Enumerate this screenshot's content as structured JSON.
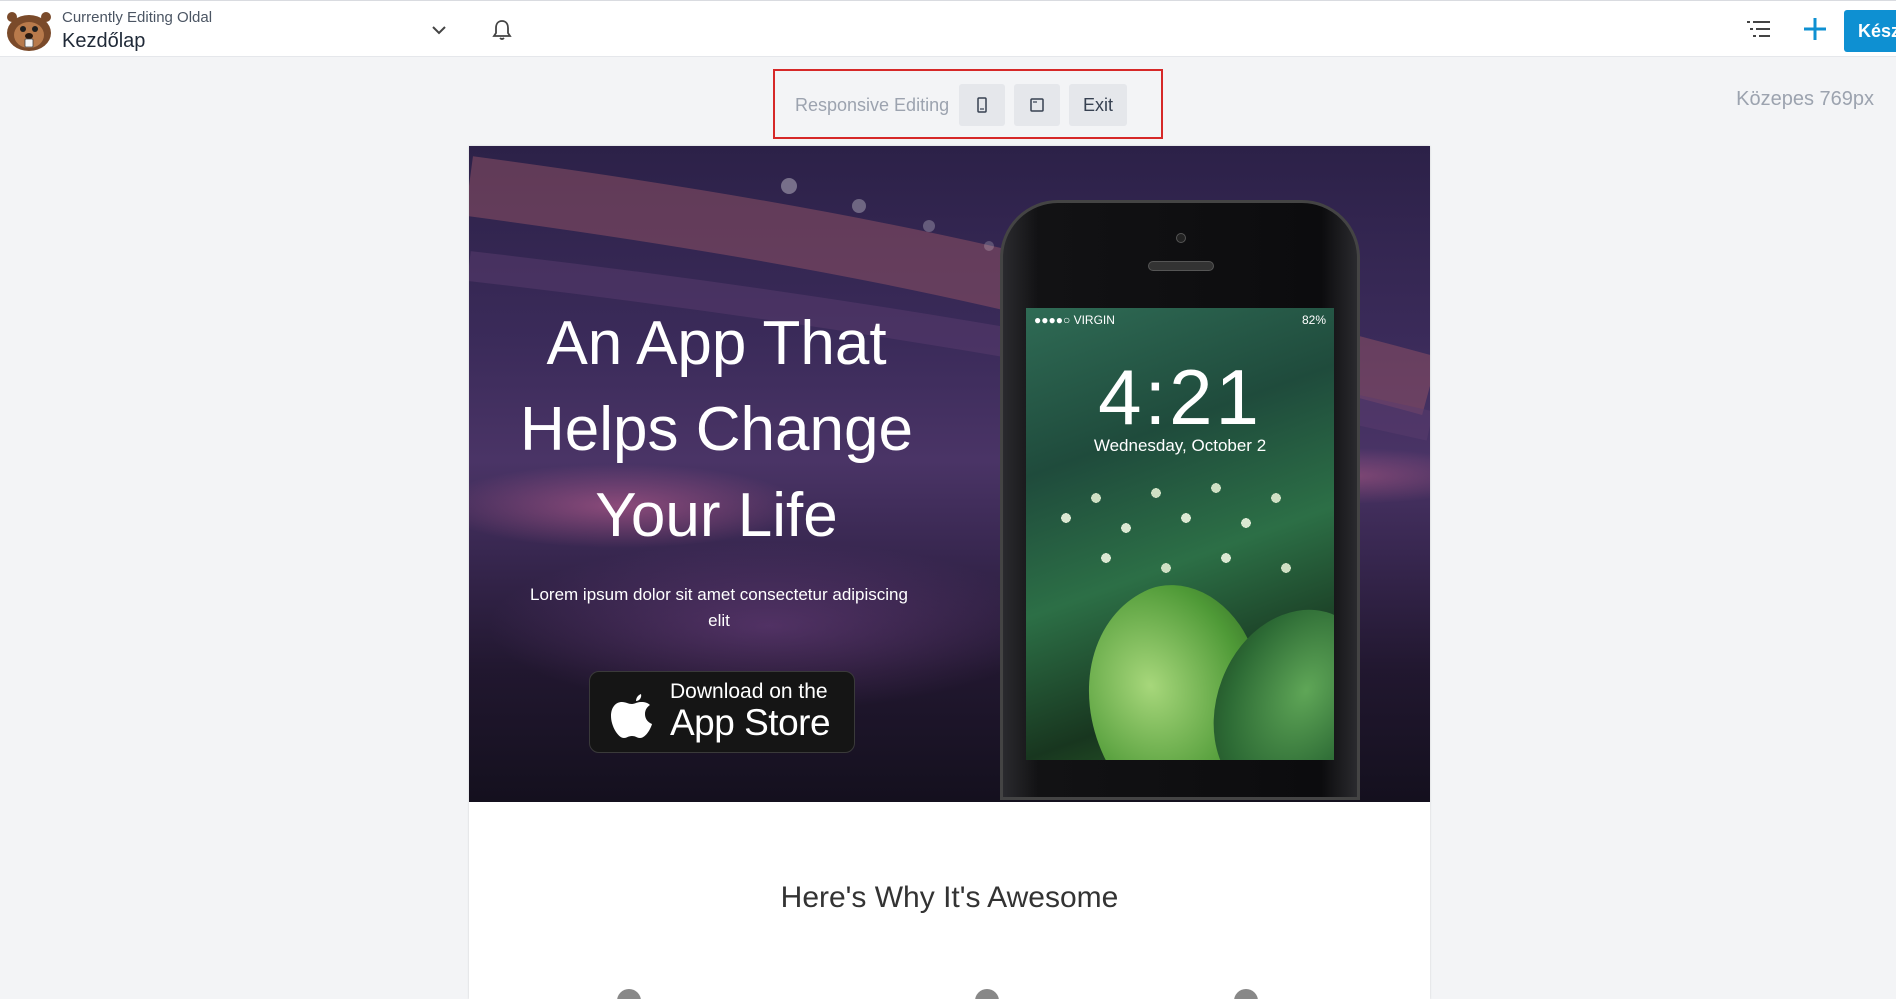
{
  "topbar": {
    "editing_label": "Currently Editing Oldal",
    "editing_title": "Kezdőlap",
    "done_label": "Kész"
  },
  "responsive": {
    "label": "Responsive Editing",
    "exit_label": "Exit",
    "breakpoint": "Közepes 769px"
  },
  "hero": {
    "title": "An App That Helps Change Your Life",
    "subtitle": "Lorem ipsum dolor sit amet consectetur adipiscing elit",
    "appstore_small": "Download on the",
    "appstore_big": "App Store",
    "phone": {
      "carrier": "●●●●○ VIRGIN",
      "battery": "82%",
      "time": "4:21",
      "date": "Wednesday, October 2"
    }
  },
  "section": {
    "heading": "Here's Why It's Awesome"
  },
  "colors": {
    "accent": "#0e90d2",
    "highlight_border": "#d62828"
  }
}
